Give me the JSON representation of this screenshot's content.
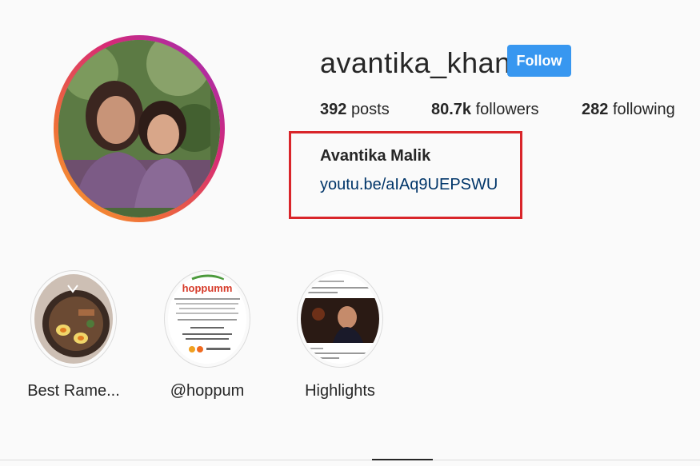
{
  "profile": {
    "username": "avantika_khan",
    "follow_label": "Follow",
    "stats": {
      "posts_count": "392",
      "posts_label": "posts",
      "followers_count": "80.7k",
      "followers_label": "followers",
      "following_count": "282",
      "following_label": "following"
    },
    "full_name": "Avantika Malik",
    "link": "youtu.be/aIAq9UEPSWU"
  },
  "highlights": [
    {
      "label": "Best Rame..."
    },
    {
      "label": "@hoppum",
      "card_brand": "hoppumm"
    },
    {
      "label": "Highlights"
    }
  ],
  "colors": {
    "follow_button": "#3897f0",
    "link": "#003569",
    "annotation_box": "#d9252a"
  }
}
